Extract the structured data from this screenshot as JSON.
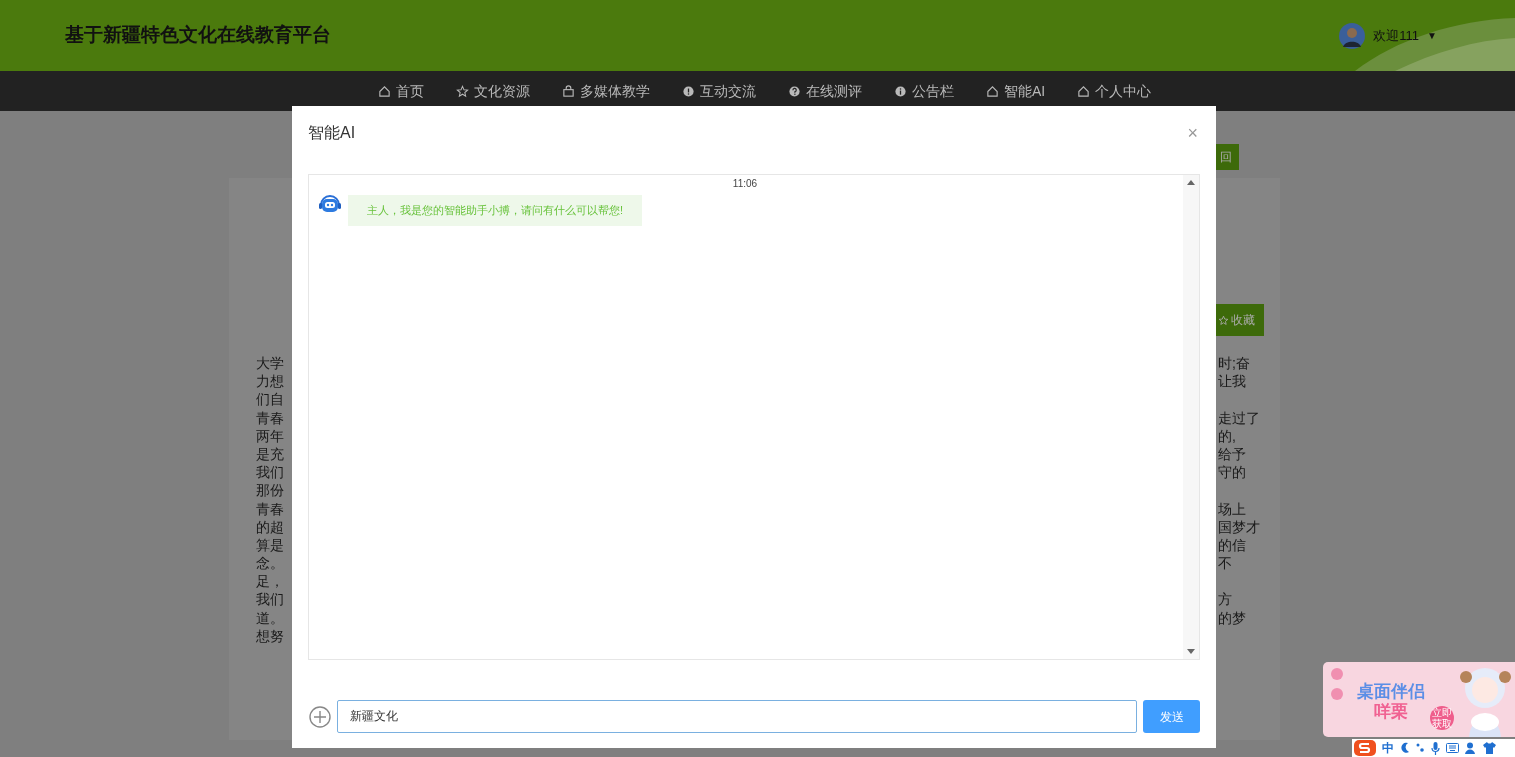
{
  "header": {
    "title": "基于新疆特色文化在线教育平台",
    "welcome": "欢迎111",
    "caret": "▼"
  },
  "nav": [
    {
      "label": "首页"
    },
    {
      "label": "文化资源"
    },
    {
      "label": "多媒体教学"
    },
    {
      "label": "互动交流"
    },
    {
      "label": "在线测评"
    },
    {
      "label": "公告栏"
    },
    {
      "label": "智能AI"
    },
    {
      "label": "个人中心"
    }
  ],
  "page": {
    "back_button": "回",
    "favorite_button": "收藏",
    "rows": [
      {
        "left": "大学",
        "right": "时;奋"
      },
      {
        "left": "力想",
        "right": "让我"
      },
      {
        "left": "们自"
      },
      {
        "left": "青春",
        "right": "走过了"
      },
      {
        "left": "两年",
        "right": "的,"
      },
      {
        "left": "是充",
        "right": "给予"
      },
      {
        "left": "我们",
        "right": "守的"
      },
      {
        "left": "那份"
      },
      {
        "left": "青春",
        "right": "场上"
      },
      {
        "left": "的超",
        "right": "国梦才"
      },
      {
        "left": "算是",
        "right": "的信"
      },
      {
        "left": "念。",
        "right": "不"
      },
      {
        "left": "足，"
      },
      {
        "left": "我们",
        "right": "方"
      },
      {
        "left": "道。",
        "right": "的梦"
      },
      {
        "left": "想努"
      }
    ]
  },
  "dialog": {
    "title": "智能AI",
    "close": "×",
    "messages": [
      {
        "time": "11:06",
        "text": "主人，我是您的智能助手小搏，请问有什么可以帮您!"
      }
    ],
    "input": {
      "value": "新疆文化"
    },
    "send_button": "发送"
  },
  "ad": {
    "title": "桌面伴侣",
    "name": "咩栗",
    "action": "立即获取"
  },
  "ime": {
    "mode": "中"
  }
}
